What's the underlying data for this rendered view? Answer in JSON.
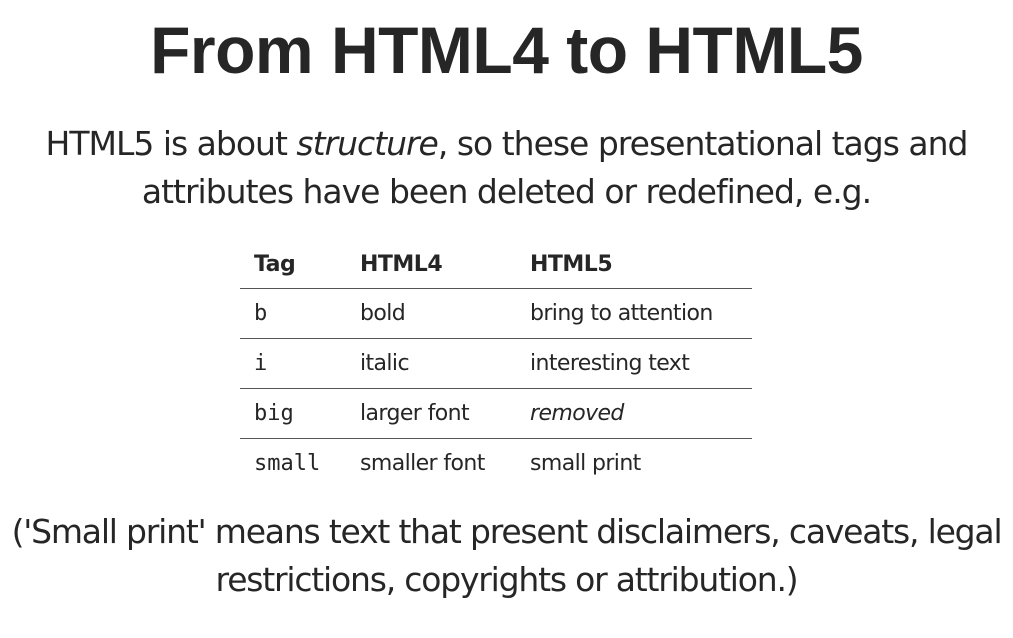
{
  "title": "From HTML4 to HTML5",
  "intro": {
    "before": "HTML5 is about ",
    "emphasis": "structure",
    "after": ", so these presentational tags and attributes have been deleted or redefined, e.g."
  },
  "table": {
    "headers": [
      "Tag",
      "HTML4",
      "HTML5"
    ],
    "rows": [
      {
        "tag": "b",
        "html4": "bold",
        "html5": "bring to attention"
      },
      {
        "tag": "i",
        "html4": "italic",
        "html5": "interesting text"
      },
      {
        "tag": "big",
        "html4": "larger font",
        "html5": "removed"
      },
      {
        "tag": "small",
        "html4": "smaller font",
        "html5": "small print"
      }
    ]
  },
  "note": "('Small print' means text that present disclaimers, caveats, legal restrictions, copyrights or attribution.)"
}
